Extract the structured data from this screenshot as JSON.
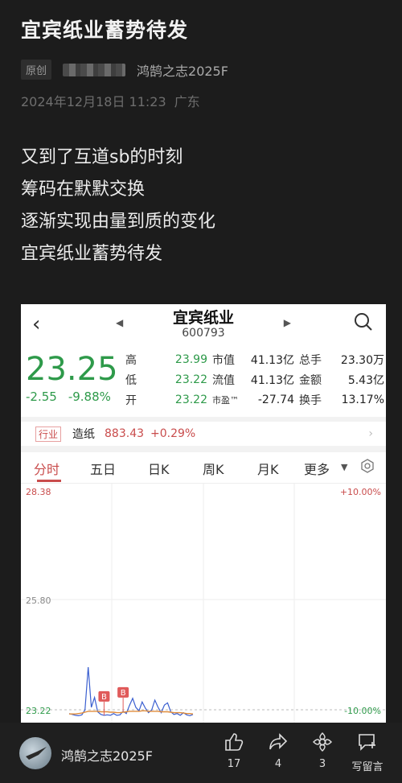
{
  "article": {
    "title": "宜宾纸业蓄势待发",
    "badge": "原创",
    "author": "鸿鹄之志2025F",
    "date": "2024年12月18日 11:23",
    "location": "广东",
    "lines": [
      "又到了互道sb的时刻",
      "筹码在默默交换",
      "逐渐实现由量到质的变化",
      "宜宾纸业蓄势待发"
    ]
  },
  "stock": {
    "name": "宜宾纸业",
    "code": "600793",
    "price": "23.25",
    "change": "-2.55",
    "change_pct": "-9.88%",
    "stats": [
      {
        "l1": "高",
        "v1": "23.99",
        "l2": "市值",
        "v2": "41.13亿",
        "l3": "总手",
        "v3": "23.30万"
      },
      {
        "l1": "低",
        "v1": "23.22",
        "l2": "流值",
        "v2": "41.13亿",
        "l3": "金额",
        "v3": "5.43亿"
      },
      {
        "l1": "开",
        "v1": "23.22",
        "l2": "市盈™",
        "v2": "-27.74",
        "l3": "换手",
        "v3": "13.17%"
      }
    ],
    "industry": {
      "tag": "行业",
      "name": "造纸",
      "value": "883.43",
      "pct": "+0.29%"
    },
    "tabs": [
      "分时",
      "五日",
      "日K",
      "周K",
      "月K",
      "更多"
    ],
    "colors": {
      "down": "#2e9a4a",
      "up": "#c94c4c"
    }
  },
  "chart_data": {
    "type": "line",
    "y_labels_left": [
      "28.38",
      "25.80",
      "23.22"
    ],
    "y_labels_right": [
      "+10.00%",
      "-10.00%"
    ],
    "ylim": [
      23.22,
      28.38
    ],
    "markers": [
      "B",
      "B"
    ],
    "series": [
      {
        "values": [
          23.28,
          23.26,
          23.24,
          23.23,
          23.25,
          23.36,
          24.32,
          23.42,
          23.64,
          23.32,
          23.26,
          23.24,
          23.25,
          23.24,
          23.28,
          23.24,
          23.25,
          23.33,
          23.28,
          23.46,
          23.62,
          23.42,
          23.34,
          23.54,
          23.4,
          23.3,
          23.36,
          23.58,
          23.42,
          23.3,
          23.47,
          23.52,
          23.32,
          23.26,
          23.28,
          23.24,
          23.3,
          23.25,
          23.23,
          23.26
        ]
      },
      {
        "values": [
          23.27,
          23.27,
          23.27,
          23.28,
          23.29,
          23.31,
          23.33,
          23.33,
          23.33,
          23.33,
          23.32,
          23.32,
          23.32,
          23.31,
          23.31,
          23.3,
          23.3,
          23.31,
          23.32,
          23.33,
          23.33,
          23.33,
          23.33,
          23.34,
          23.34,
          23.33,
          23.33,
          23.33,
          23.33,
          23.32,
          23.32,
          23.32,
          23.31,
          23.3,
          23.3,
          23.3,
          23.29,
          23.28,
          23.28,
          23.27
        ]
      }
    ]
  },
  "bottom_bar": {
    "author": "鸿鹄之志2025F",
    "like_count": "17",
    "share_count": "4",
    "collect_count": "3",
    "comment_label": "写留言"
  }
}
